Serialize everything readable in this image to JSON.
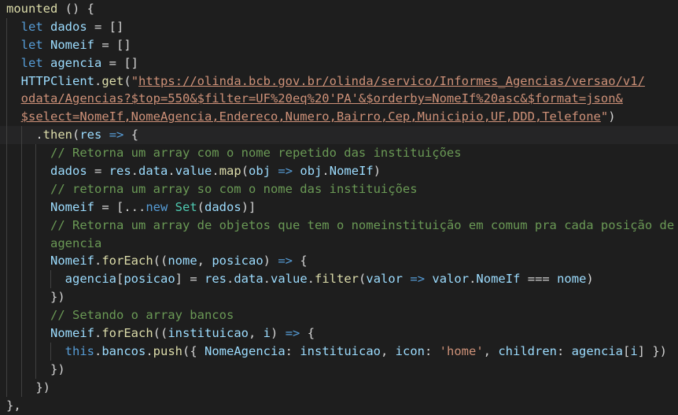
{
  "theme": {
    "background": "#1e1e1e",
    "current_line": "#252526",
    "indent_guide": "#404040",
    "colors": {
      "plain": "#d4d4d4",
      "keyword": "#569cd6",
      "variable": "#9cdcfe",
      "function": "#dcdcaa",
      "string": "#ce9178",
      "class": "#4ec9b0",
      "comment": "#6a9955"
    }
  },
  "lines": [
    {
      "indent": 0,
      "tokens": [
        [
          "fn",
          "mounted"
        ],
        [
          "plain",
          " () {"
        ]
      ]
    },
    {
      "indent": 1,
      "tokens": [
        [
          "kw",
          "let"
        ],
        [
          "plain",
          " "
        ],
        [
          "var",
          "dados"
        ],
        [
          "plain",
          " = []"
        ]
      ]
    },
    {
      "indent": 1,
      "tokens": [
        [
          "kw",
          "let"
        ],
        [
          "plain",
          " "
        ],
        [
          "var",
          "Nomeif"
        ],
        [
          "plain",
          " = []"
        ]
      ]
    },
    {
      "indent": 1,
      "tokens": [
        [
          "kw",
          "let"
        ],
        [
          "plain",
          " "
        ],
        [
          "var",
          "agencia"
        ],
        [
          "plain",
          " = []"
        ]
      ]
    },
    {
      "indent": 1,
      "tokens": [
        [
          "var",
          "HTTPClient"
        ],
        [
          "plain",
          "."
        ],
        [
          "fn",
          "get"
        ],
        [
          "plain",
          "("
        ],
        [
          "str",
          "\""
        ],
        [
          "url",
          "https://olinda.bcb.gov.br/olinda/servico/Informes_Agencias/versao/v1/"
        ]
      ]
    },
    {
      "indent": 1,
      "tokens": [
        [
          "url",
          "odata/Agencias?$top=550&$filter=UF%20eq%20'PA'&$orderby=NomeIf%20asc&$format=json&"
        ]
      ]
    },
    {
      "indent": 1,
      "tokens": [
        [
          "url",
          "$select=NomeIf,NomeAgencia,Endereco,Numero,Bairro,Cep,Municipio,UF,DDD,Telefone"
        ],
        [
          "str",
          "\""
        ],
        [
          "plain",
          ")"
        ]
      ]
    },
    {
      "indent": 2,
      "tokens": [
        [
          "plain",
          "."
        ],
        [
          "fn",
          "then"
        ],
        [
          "plain",
          "("
        ],
        [
          "var",
          "res"
        ],
        [
          "plain",
          " "
        ],
        [
          "kw",
          "=>"
        ],
        [
          "plain",
          " {"
        ]
      ],
      "highlight": true
    },
    {
      "indent": 3,
      "tokens": [
        [
          "cmt",
          "// Retorna um array com o nome repetido das instituições"
        ]
      ]
    },
    {
      "indent": 3,
      "tokens": [
        [
          "var",
          "dados"
        ],
        [
          "plain",
          " = "
        ],
        [
          "var",
          "res"
        ],
        [
          "plain",
          "."
        ],
        [
          "var",
          "data"
        ],
        [
          "plain",
          "."
        ],
        [
          "var",
          "value"
        ],
        [
          "plain",
          "."
        ],
        [
          "fn",
          "map"
        ],
        [
          "plain",
          "("
        ],
        [
          "var",
          "obj"
        ],
        [
          "plain",
          " "
        ],
        [
          "kw",
          "=>"
        ],
        [
          "plain",
          " "
        ],
        [
          "var",
          "obj"
        ],
        [
          "plain",
          "."
        ],
        [
          "var",
          "NomeIf"
        ],
        [
          "plain",
          ")"
        ]
      ]
    },
    {
      "indent": 3,
      "tokens": [
        [
          "cmt",
          "// retorna um array so com o nome das instituições"
        ]
      ]
    },
    {
      "indent": 3,
      "tokens": [
        [
          "var",
          "Nomeif"
        ],
        [
          "plain",
          " = [..."
        ],
        [
          "kw",
          "new"
        ],
        [
          "plain",
          " "
        ],
        [
          "cls",
          "Set"
        ],
        [
          "plain",
          "("
        ],
        [
          "var",
          "dados"
        ],
        [
          "plain",
          ")]"
        ]
      ]
    },
    {
      "indent": 3,
      "tokens": [
        [
          "cmt",
          "// Retorna um array de objetos que tem o nomeinstituição em comum pra cada posição de"
        ]
      ]
    },
    {
      "indent": 3,
      "tokens": [
        [
          "cmt",
          "agencia"
        ]
      ]
    },
    {
      "indent": 3,
      "tokens": [
        [
          "var",
          "Nomeif"
        ],
        [
          "plain",
          "."
        ],
        [
          "fn",
          "forEach"
        ],
        [
          "plain",
          "(("
        ],
        [
          "var",
          "nome"
        ],
        [
          "plain",
          ", "
        ],
        [
          "var",
          "posicao"
        ],
        [
          "plain",
          ") "
        ],
        [
          "kw",
          "=>"
        ],
        [
          "plain",
          " {"
        ]
      ]
    },
    {
      "indent": 4,
      "tokens": [
        [
          "var",
          "agencia"
        ],
        [
          "plain",
          "["
        ],
        [
          "var",
          "posicao"
        ],
        [
          "plain",
          "] = "
        ],
        [
          "var",
          "res"
        ],
        [
          "plain",
          "."
        ],
        [
          "var",
          "data"
        ],
        [
          "plain",
          "."
        ],
        [
          "var",
          "value"
        ],
        [
          "plain",
          "."
        ],
        [
          "fn",
          "filter"
        ],
        [
          "plain",
          "("
        ],
        [
          "var",
          "valor"
        ],
        [
          "plain",
          " "
        ],
        [
          "kw",
          "=>"
        ],
        [
          "plain",
          " "
        ],
        [
          "var",
          "valor"
        ],
        [
          "plain",
          "."
        ],
        [
          "var",
          "NomeIf"
        ],
        [
          "plain",
          " === "
        ],
        [
          "var",
          "nome"
        ],
        [
          "plain",
          ")"
        ]
      ]
    },
    {
      "indent": 3,
      "tokens": [
        [
          "plain",
          "})"
        ]
      ]
    },
    {
      "indent": 3,
      "tokens": [
        [
          "cmt",
          "// Setando o array bancos"
        ]
      ]
    },
    {
      "indent": 3,
      "tokens": [
        [
          "var",
          "Nomeif"
        ],
        [
          "plain",
          "."
        ],
        [
          "fn",
          "forEach"
        ],
        [
          "plain",
          "(("
        ],
        [
          "var",
          "instituicao"
        ],
        [
          "plain",
          ", "
        ],
        [
          "var",
          "i"
        ],
        [
          "plain",
          ") "
        ],
        [
          "kw",
          "=>"
        ],
        [
          "plain",
          " {"
        ]
      ]
    },
    {
      "indent": 4,
      "tokens": [
        [
          "kw",
          "this"
        ],
        [
          "plain",
          "."
        ],
        [
          "var",
          "bancos"
        ],
        [
          "plain",
          "."
        ],
        [
          "fn",
          "push"
        ],
        [
          "plain",
          "({ "
        ],
        [
          "var",
          "NomeAgencia"
        ],
        [
          "plain",
          ": "
        ],
        [
          "var",
          "instituicao"
        ],
        [
          "plain",
          ", "
        ],
        [
          "var",
          "icon"
        ],
        [
          "plain",
          ": "
        ],
        [
          "str",
          "'home'"
        ],
        [
          "plain",
          ", "
        ],
        [
          "var",
          "children"
        ],
        [
          "plain",
          ": "
        ],
        [
          "var",
          "agencia"
        ],
        [
          "plain",
          "["
        ],
        [
          "var",
          "i"
        ],
        [
          "plain",
          "] })"
        ]
      ]
    },
    {
      "indent": 3,
      "tokens": [
        [
          "plain",
          "})"
        ]
      ]
    },
    {
      "indent": 2,
      "tokens": [
        [
          "plain",
          "})"
        ]
      ]
    },
    {
      "indent": 0,
      "tokens": [
        [
          "plain",
          "},"
        ]
      ]
    }
  ]
}
